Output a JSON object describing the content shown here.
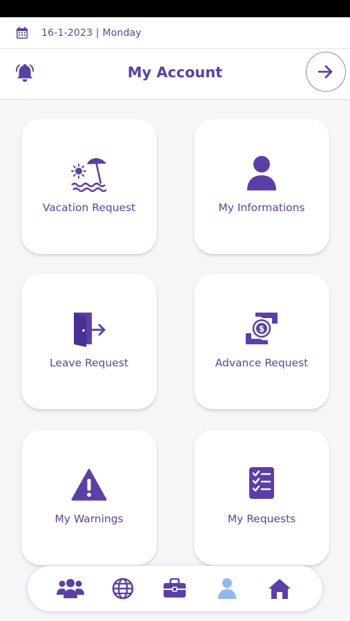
{
  "date_bar": {
    "date": "16-1-2023 | Monday",
    "icon": "calendar-icon"
  },
  "header": {
    "title": "My Account",
    "left_icon": "bell-icon",
    "right_icon": "arrow-right-icon"
  },
  "cards": [
    {
      "label": "Vacation Request",
      "icon": "beach-umbrella-icon"
    },
    {
      "label": "My Informations",
      "icon": "user-icon"
    },
    {
      "label": "Leave Request",
      "icon": "door-exit-icon"
    },
    {
      "label": "Advance Request",
      "icon": "money-hand-icon"
    },
    {
      "label": "My Warnings",
      "icon": "warning-icon"
    },
    {
      "label": "My Requests",
      "icon": "checklist-icon"
    }
  ],
  "bottom_nav": {
    "items": [
      {
        "icon": "users-group-icon"
      },
      {
        "icon": "globe-icon"
      },
      {
        "icon": "briefcase-icon"
      },
      {
        "icon": "user-icon",
        "active": true
      },
      {
        "icon": "home-icon"
      }
    ]
  },
  "colors": {
    "accent": "#5b3fa8",
    "active_nav": "#8fb8f2",
    "background": "#f6f5f7"
  }
}
